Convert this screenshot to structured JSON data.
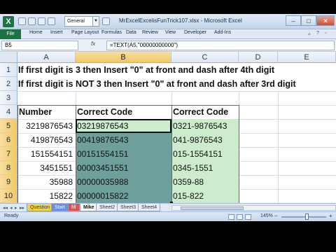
{
  "app": {
    "window_title": "MrExcelExcelisFunTrick107.xlsx - Microsoft Excel",
    "qat_style_combo": "General",
    "window_buttons": [
      "–",
      "□",
      "✕"
    ]
  },
  "ribbon": {
    "file_tab": "File",
    "tabs": [
      "Home",
      "Insert",
      "Page Layout",
      "Formulas",
      "Data",
      "Review",
      "View",
      "Developer",
      "Add-Ins"
    ]
  },
  "formula_bar": {
    "name_box": "B5",
    "fx_label": "fx",
    "formula": "=TEXT(A5,\"00000000000\")"
  },
  "columns": [
    "A",
    "B",
    "C",
    "D",
    "E"
  ],
  "rows": [
    "1",
    "2",
    "3",
    "4",
    "5",
    "6",
    "7",
    "8",
    "9",
    "10",
    "11"
  ],
  "notes": {
    "row1": "If first digit is 3 then Insert \"0\" at front and dash after 4th digit",
    "row2": "If first digit is NOT 3 then Insert \"0\" at front and dash after 3rd digit"
  },
  "table": {
    "headers": {
      "number": "Number",
      "correct_code_b": "Correct Code",
      "correct_code_c": "Correct Code"
    },
    "rows": [
      {
        "number": "3219876543",
        "code_b": "03219876543",
        "code_c": "0321-9876543"
      },
      {
        "number": "419876543",
        "code_b": "00419876543",
        "code_c": "041-9876543"
      },
      {
        "number": "151554151",
        "code_b": "00151554151",
        "code_c": "015-1554151"
      },
      {
        "number": "3451551",
        "code_b": "00003451551",
        "code_c": "0345-1551"
      },
      {
        "number": "35988",
        "code_b": "00000035988",
        "code_c": "0359-88"
      },
      {
        "number": "15822",
        "code_b": "00000015822",
        "code_c": "015-822"
      }
    ]
  },
  "sheets": {
    "tabs": [
      "Question",
      "Start",
      "fill",
      "Mike",
      "Sheet2",
      "Sheet3",
      "Sheet4"
    ],
    "active": "Mike"
  },
  "status": {
    "ready": "Ready",
    "zoom": "145%"
  },
  "colors": {
    "accent_green": "#1e7145",
    "cell_green": "#cdeccd",
    "cell_teal": "#6f9f9b"
  }
}
